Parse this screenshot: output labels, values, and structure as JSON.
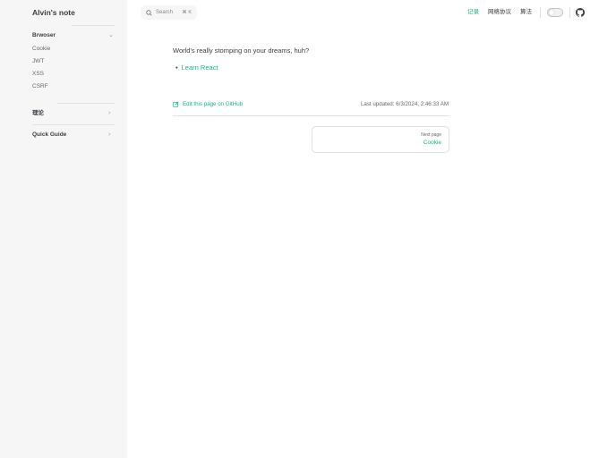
{
  "sidebar": {
    "title": "Alvin's note",
    "sections": [
      {
        "label": "Brwoser",
        "items": [
          "Cookie",
          "JWT",
          "XSS",
          "CSRF"
        ]
      },
      {
        "label": "理论"
      },
      {
        "label": "Quick Guide"
      }
    ]
  },
  "search": {
    "label": "Search",
    "shortcut": "⌘ K"
  },
  "nav": {
    "items": [
      "记录",
      "网络协议",
      "算法"
    ],
    "active": "记录"
  },
  "content": {
    "paragraph": "World's really stomping on your dreams, huh?",
    "list": [
      "Learn React"
    ]
  },
  "footer": {
    "edit_link": "Edit this page on GitHub",
    "last_updated": "Last updated: 6/3/2024, 2:46:33 AM",
    "next_label": "Next page",
    "next_title": "Cookie"
  },
  "colors": {
    "brand": "#10b981",
    "sidebar_bg": "#f6f6f7"
  }
}
